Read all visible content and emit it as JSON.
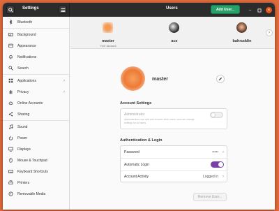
{
  "headerbar": {
    "settings_title": "Settings",
    "users_title": "Users",
    "add_user_label": "Add User..."
  },
  "sidebar": {
    "items": [
      {
        "label": "Bluetooth",
        "icon": "bluetooth-icon"
      },
      {
        "label": "Background",
        "icon": "background-icon"
      },
      {
        "label": "Appearance",
        "icon": "appearance-icon"
      },
      {
        "label": "Notifications",
        "icon": "bell-icon"
      },
      {
        "label": "Search",
        "icon": "search-icon"
      },
      {
        "label": "Applications",
        "icon": "grid-icon"
      },
      {
        "label": "Privacy",
        "icon": "hand-icon"
      },
      {
        "label": "Online Accounts",
        "icon": "cloud-icon"
      },
      {
        "label": "Sharing",
        "icon": "share-icon"
      },
      {
        "label": "Sound",
        "icon": "music-icon"
      },
      {
        "label": "Power",
        "icon": "power-icon"
      },
      {
        "label": "Displays",
        "icon": "display-icon"
      },
      {
        "label": "Mouse & Touchpad",
        "icon": "mouse-icon"
      },
      {
        "label": "Keyboard Shortcuts",
        "icon": "keyboard-icon"
      },
      {
        "label": "Printers",
        "icon": "printer-icon"
      },
      {
        "label": "Removable Media",
        "icon": "media-icon"
      }
    ]
  },
  "users": [
    {
      "name": "master",
      "subtitle": "Your account"
    },
    {
      "name": "ace",
      "subtitle": ""
    },
    {
      "name": "bahruddin",
      "subtitle": ""
    }
  ],
  "profile": {
    "name": "master"
  },
  "account_settings": {
    "title": "Account Settings",
    "admin_label": "Administrator",
    "admin_desc": "Administrators can add and remove other users, and can change settings for all users.",
    "admin_enabled": false
  },
  "auth": {
    "title": "Authentication & Login",
    "password_label": "Password",
    "password_value": "•••••",
    "autologin_label": "Automatic Login",
    "autologin_enabled": true,
    "activity_label": "Account Activity",
    "activity_value": "Logged in"
  },
  "remove_user_label": "Remove User...",
  "colors": {
    "accent_toggle": "#7b3fa8",
    "add_user_green": "#26a269",
    "close_button": "#e95420",
    "desktop": "#e06a3a"
  }
}
